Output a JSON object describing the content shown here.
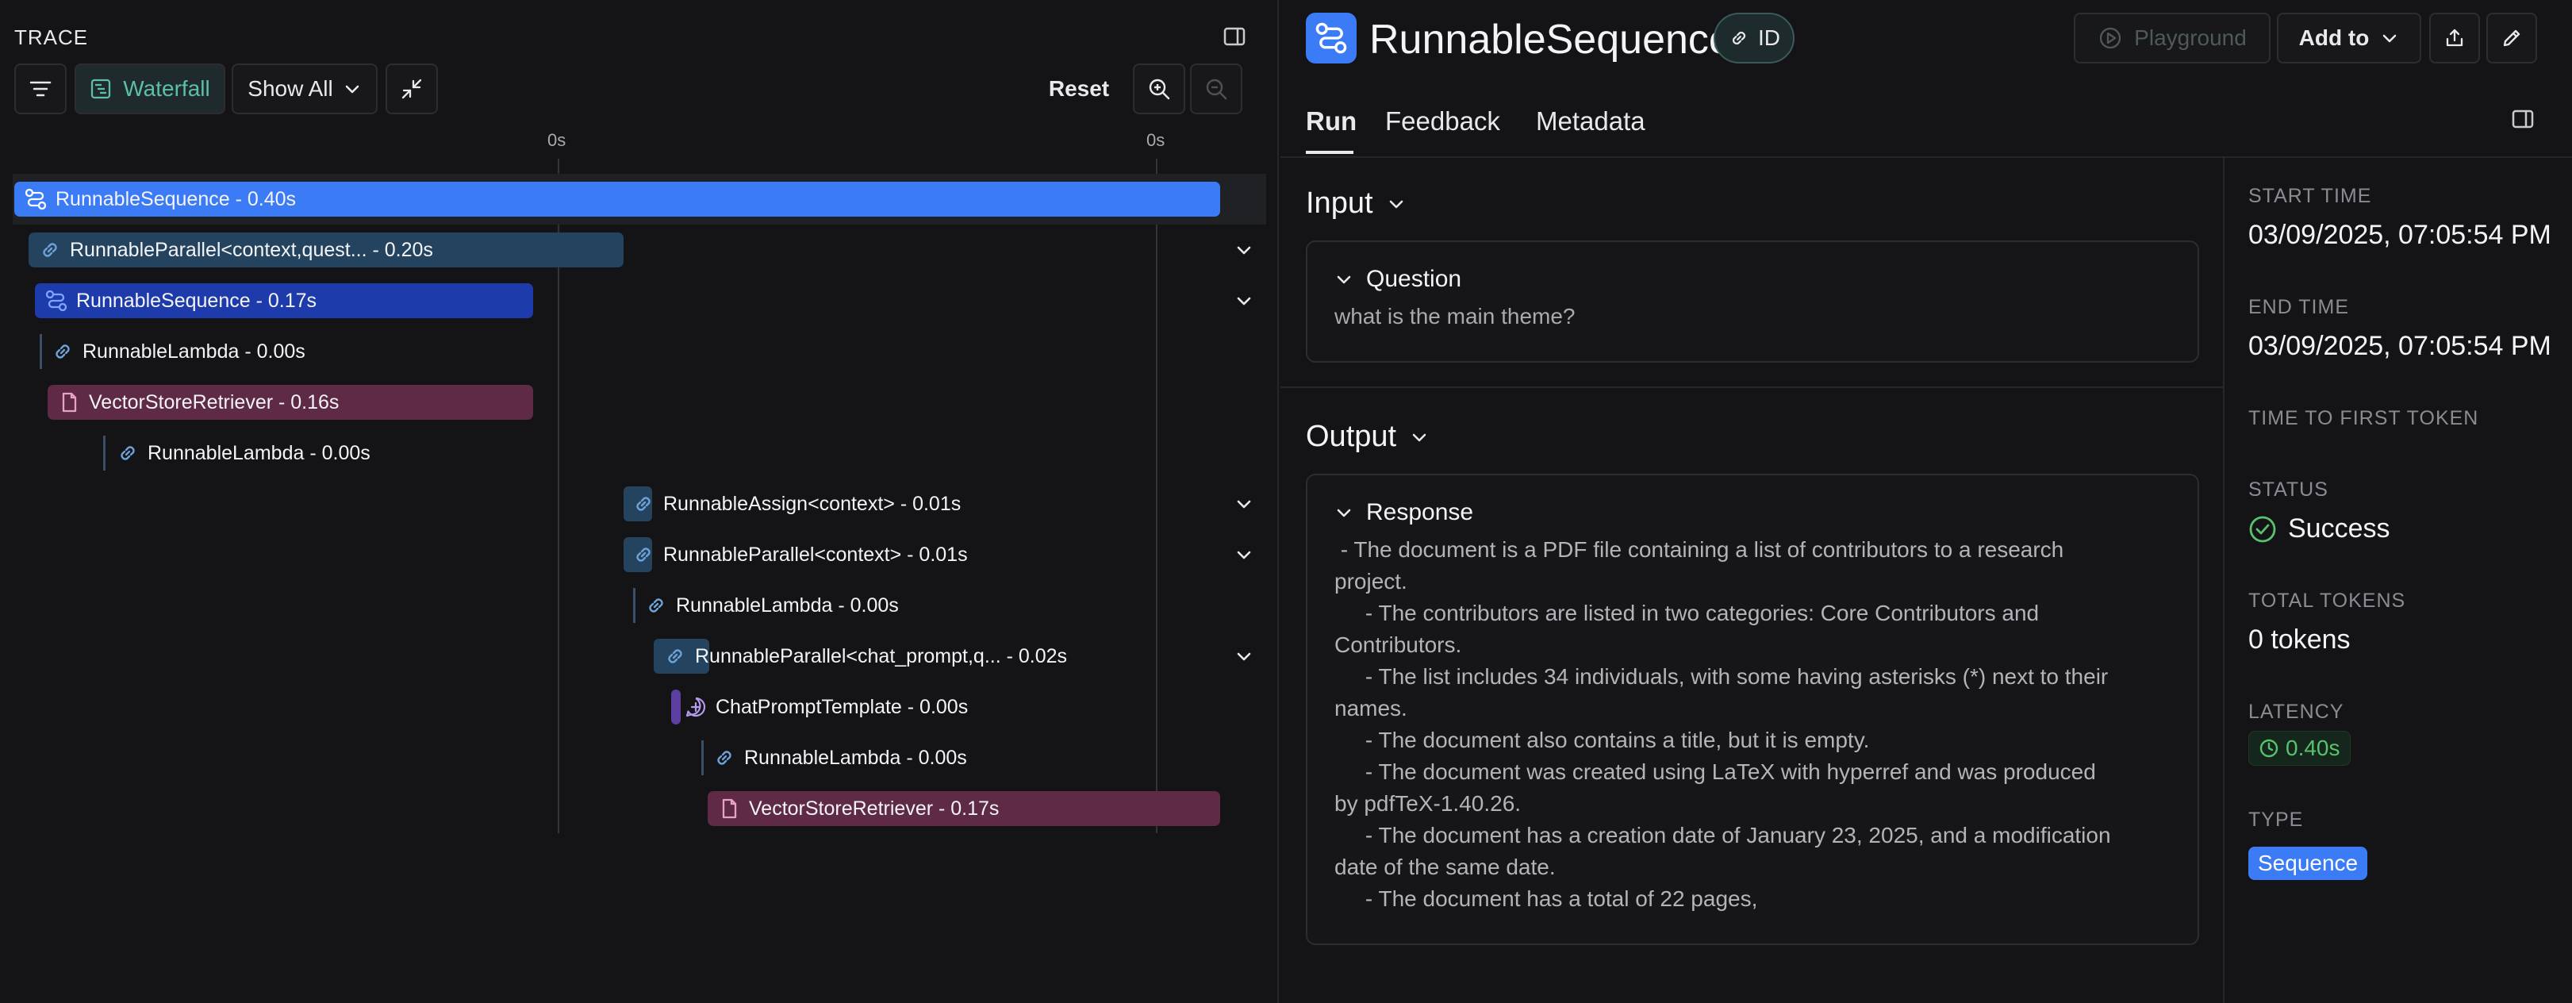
{
  "trace": {
    "title": "TRACE",
    "filter_icon": "filter-lines-icon",
    "waterfall_label": "Waterfall",
    "show_all_label": "Show All",
    "reset_label": "Reset",
    "tick_left": "0s",
    "tick_right": "0s",
    "runs": [
      {
        "name": "RunnableSequence - 0.40s",
        "icon": "sequence-icon",
        "color": "#3b7cf6"
      },
      {
        "name": "RunnableParallel<context,quest... - 0.20s",
        "icon": "link-icon",
        "color": "#23435f"
      },
      {
        "name": "RunnableSequence - 0.17s",
        "icon": "sequence-icon",
        "color": "#1e3bab"
      },
      {
        "name": "RunnableLambda - 0.00s",
        "icon": "link-icon"
      },
      {
        "name": "VectorStoreRetriever - 0.16s",
        "icon": "document-icon",
        "color": "#5e2a45"
      },
      {
        "name": "RunnableLambda - 0.00s",
        "icon": "link-icon"
      },
      {
        "name": "RunnableAssign<context> - 0.01s",
        "icon": "link-icon"
      },
      {
        "name": "RunnableParallel<context> - 0.01s",
        "icon": "link-icon"
      },
      {
        "name": "RunnableLambda - 0.00s",
        "icon": "link-icon"
      },
      {
        "name": "RunnableParallel<chat_prompt,q... - 0.02s",
        "icon": "link-icon"
      },
      {
        "name": "ChatPromptTemplate - 0.00s",
        "icon": "chat-prompt-icon"
      },
      {
        "name": "RunnableLambda - 0.00s",
        "icon": "link-icon"
      },
      {
        "name": "VectorStoreRetriever - 0.17s",
        "icon": "document-icon",
        "color": "#5e2a45"
      }
    ]
  },
  "detail": {
    "title": "RunnableSequence",
    "id_label": "ID",
    "playground_label": "Playground",
    "add_to_label": "Add to",
    "tabs": [
      "Run",
      "Feedback",
      "Metadata"
    ],
    "input": {
      "section_label": "Input",
      "field_label": "Question",
      "value": "what is the main theme?"
    },
    "output": {
      "section_label": "Output",
      "field_label": "Response",
      "lines": [
        " - The document is a PDF file containing a list of contributors to a research",
        "project.",
        "     - The contributors are listed in two categories: Core Contributors and",
        "Contributors.",
        "     - The list includes 34 individuals, with some having asterisks (*) next to their",
        "names.",
        "     - The document also contains a title, but it is empty.",
        "     - The document was created using LaTeX with hyperref and was produced",
        "by pdfTeX-1.40.26.",
        "     - The document has a creation date of January 23, 2025, and a modification",
        "date of the same date.",
        "     - The document has a total of 22 pages,"
      ]
    },
    "meta": {
      "start_time_label": "START TIME",
      "start_time": "03/09/2025, 07:05:54 PM",
      "end_time_label": "END TIME",
      "end_time": "03/09/2025, 07:05:54 PM",
      "ttft_label": "TIME TO FIRST TOKEN",
      "status_label": "STATUS",
      "status": "Success",
      "tokens_label": "TOTAL TOKENS",
      "tokens": "0 tokens",
      "latency_label": "LATENCY",
      "latency": "0.40s",
      "type_label": "TYPE",
      "type": "Sequence"
    },
    "colors": {
      "accent": "#3b7cf6",
      "success": "#58c26e",
      "waterfall": "#5dbfa7"
    }
  }
}
